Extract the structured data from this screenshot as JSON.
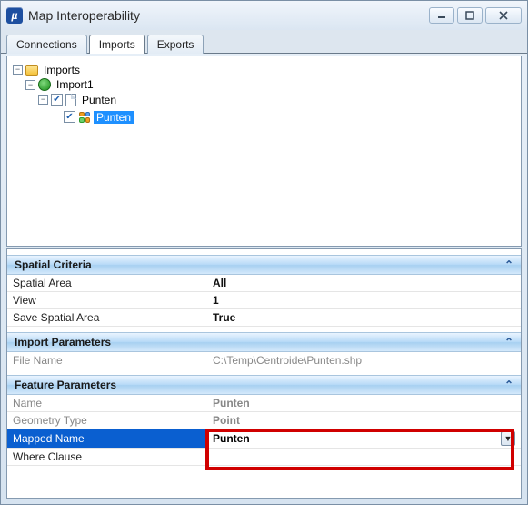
{
  "window": {
    "title": "Map Interoperability"
  },
  "tabs": {
    "connections": "Connections",
    "imports": "Imports",
    "exports": "Exports"
  },
  "tree": {
    "root": "Imports",
    "import1": "Import1",
    "layer": "Punten",
    "sublayer": "Punten"
  },
  "panels": {
    "spatial": {
      "title": "Spatial Criteria",
      "rows": {
        "spatial_area_k": "Spatial Area",
        "spatial_area_v": "All",
        "view_k": "View",
        "view_v": "1",
        "save_k": "Save Spatial Area",
        "save_v": "True"
      }
    },
    "importparams": {
      "title": "Import Parameters",
      "rows": {
        "file_k": "File Name",
        "file_v": "C:\\Temp\\Centroide\\Punten.shp"
      }
    },
    "featureparams": {
      "title": "Feature Parameters",
      "rows": {
        "name_k": "Name",
        "name_v": "Punten",
        "geom_k": "Geometry Type",
        "geom_v": "Point",
        "mapped_k": "Mapped Name",
        "mapped_v": "Punten",
        "where_k": "Where Clause",
        "where_v": ""
      }
    }
  }
}
